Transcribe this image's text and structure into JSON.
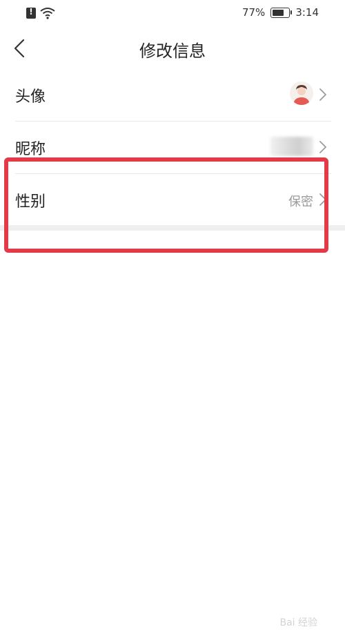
{
  "status_bar": {
    "battery_percent": "77%",
    "time": "3:14"
  },
  "header": {
    "title": "修改信息"
  },
  "rows": [
    {
      "label": "头像",
      "type": "avatar"
    },
    {
      "label": "昵称",
      "type": "blurred_value"
    },
    {
      "label": "性别",
      "type": "value",
      "value": "保密"
    }
  ],
  "colors": {
    "highlight": "#e23a48",
    "divider": "#e8e8e8",
    "value_text": "#9a9a9a"
  },
  "watermark": {
    "text": "Bai 经验"
  }
}
